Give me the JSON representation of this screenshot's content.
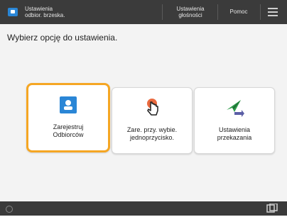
{
  "topbar": {
    "title": "Ustawienia\nodbior. brzeska.",
    "settings_label": "Ustawienia\ngłośności",
    "help_label": "Pomoc",
    "menu_icon": "menu-icon",
    "app_icon": "app-icon"
  },
  "instruction": "Wybierz opcję do ustawienia.",
  "cards": [
    {
      "label": "Zarejestruj\nOdbiorców",
      "icon": "contact-card-icon",
      "selected": true
    },
    {
      "label": "Zare. przy. wybie.\njednoprzycisko.",
      "icon": "touch-hand-icon",
      "selected": false
    },
    {
      "label": "Ustawienia\nprzekazania",
      "icon": "forward-send-icon",
      "selected": false
    }
  ],
  "colors": {
    "topbar_bg": "#3b3b3b",
    "accent_blue": "#2a86d6",
    "highlight_orange": "#f5a623",
    "touch_red": "#e85a2a",
    "forward_green": "#2e9b4a",
    "forward_purple": "#5b5ea6"
  },
  "bottombar": {
    "left_icon": "status-icon",
    "right_icon": "copy-icon"
  }
}
